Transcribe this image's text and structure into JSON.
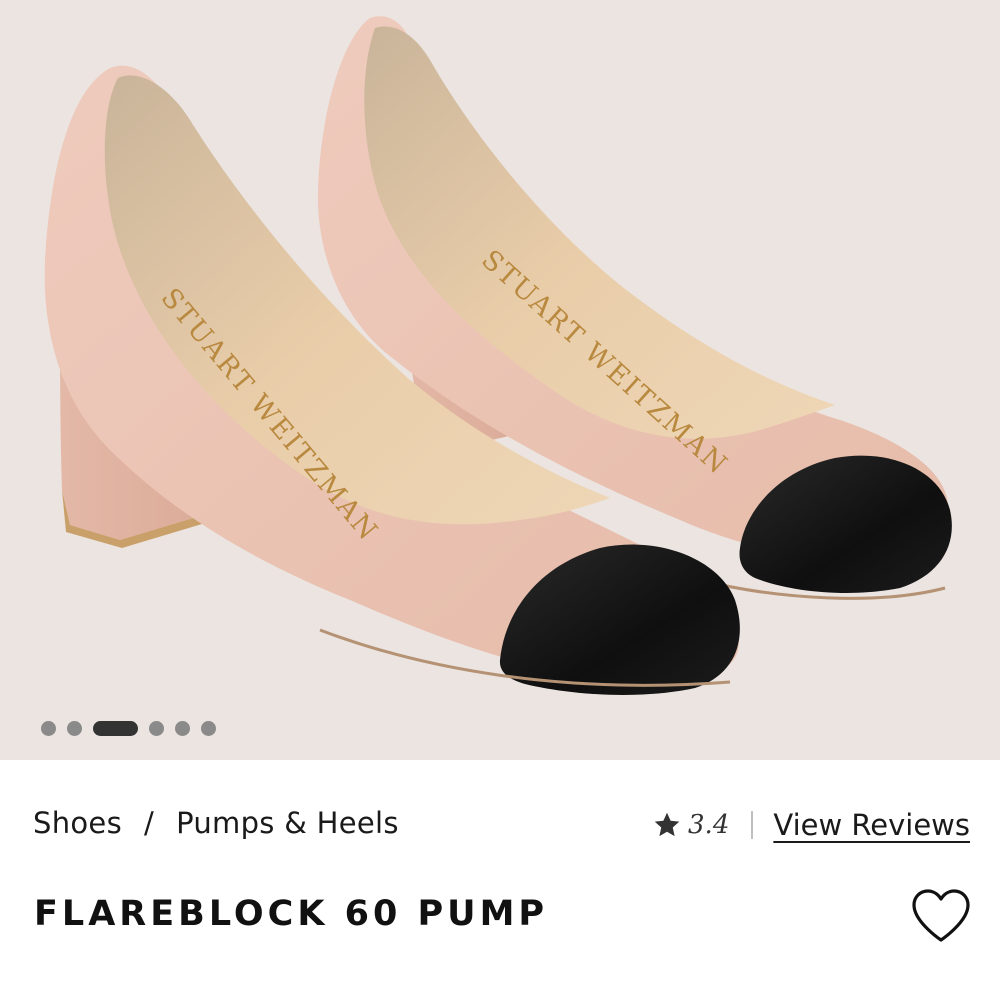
{
  "gallery": {
    "brand_mark": "STUART WEITZMAN",
    "slide_count": 6,
    "active_slide": 3
  },
  "breadcrumb": {
    "items": [
      "Shoes",
      "Pumps & Heels"
    ],
    "separator": "/"
  },
  "rating": {
    "value": "3.4",
    "icon": "star-icon",
    "reviews_link": "View Reviews"
  },
  "product": {
    "title": "FLAREBLOCK 60 PUMP"
  },
  "wishlist": {
    "icon": "heart-outline-icon"
  },
  "colors": {
    "background": "#ebe4e0",
    "upper": "#ecc6b8",
    "cap_toe": "#121212",
    "insole": "#e8caa6",
    "brand_stamp": "#b8893f"
  }
}
